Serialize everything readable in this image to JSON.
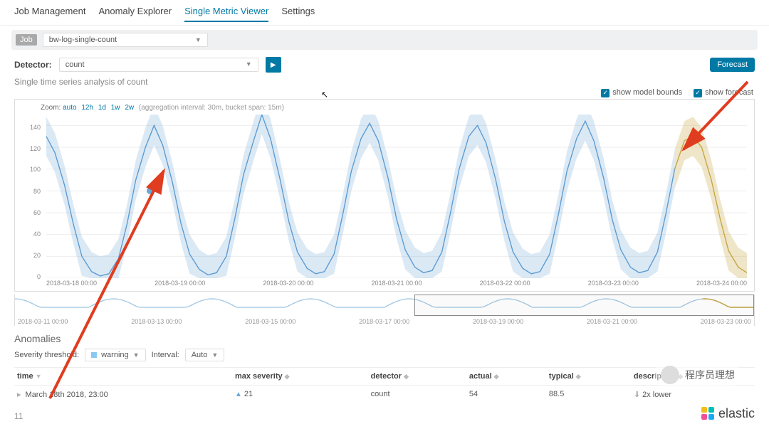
{
  "tabs": [
    "Job Management",
    "Anomaly Explorer",
    "Single Metric Viewer",
    "Settings"
  ],
  "active_tab": 2,
  "job": {
    "tag": "Job",
    "selected": "bw-log-single-count"
  },
  "detector": {
    "label": "Detector:",
    "selected": "count"
  },
  "forecast_label": "Forecast",
  "subtitle": "Single time series analysis of count",
  "checks": {
    "bounds": "show model bounds",
    "forecast": "show forecast"
  },
  "zoom": {
    "label": "Zoom:",
    "levels": [
      "auto",
      "12h",
      "1d",
      "1w",
      "2w"
    ],
    "agg": "(aggregation interval: 30m, bucket span: 15m)"
  },
  "chart_data": {
    "type": "line",
    "ylabel": "",
    "xlabel": "",
    "ylim": [
      0,
      150
    ],
    "yticks": [
      0,
      20,
      40,
      60,
      80,
      100,
      120,
      140
    ],
    "xticks": [
      "2018-03-18 00:00",
      "2018-03-19 00:00",
      "2018-03-20 00:00",
      "2018-03-21 00:00",
      "2018-03-22 00:00",
      "2018-03-23 00:00",
      "2018-03-24 00:00"
    ],
    "series": [
      {
        "name": "actual",
        "color": "#5c9bd1",
        "x": [
          0,
          0.08,
          0.17,
          0.25,
          0.33,
          0.42,
          0.5,
          0.58,
          0.67,
          0.75,
          0.83,
          0.92,
          1,
          1.08,
          1.17,
          1.25,
          1.33,
          1.42,
          1.5,
          1.58,
          1.67,
          1.75,
          1.83,
          1.92,
          2,
          2.08,
          2.17,
          2.25,
          2.33,
          2.42,
          2.5,
          2.58,
          2.67,
          2.75,
          2.83,
          2.92,
          3,
          3.08,
          3.17,
          3.25,
          3.33,
          3.42,
          3.5,
          3.58,
          3.67,
          3.75,
          3.83,
          3.92,
          4,
          4.08,
          4.17,
          4.25,
          4.33,
          4.42,
          4.5,
          4.58,
          4.67,
          4.75,
          4.83,
          4.92,
          5,
          5.08,
          5.17,
          5.25,
          5.33,
          5.42,
          5.5,
          5.58,
          5.67,
          5.75,
          5.83
        ],
        "values": [
          130,
          115,
          85,
          50,
          20,
          6,
          2,
          4,
          18,
          50,
          90,
          120,
          140,
          122,
          88,
          50,
          22,
          8,
          3,
          5,
          20,
          55,
          95,
          125,
          150,
          128,
          90,
          52,
          24,
          9,
          4,
          6,
          22,
          58,
          98,
          128,
          142,
          126,
          92,
          54,
          26,
          10,
          5,
          7,
          24,
          60,
          100,
          130,
          140,
          124,
          90,
          52,
          24,
          9,
          4,
          6,
          22,
          58,
          98,
          128,
          144,
          126,
          92,
          54,
          26,
          10,
          5,
          7,
          24,
          60,
          100
        ]
      },
      {
        "name": "forecast",
        "color": "#c5a642",
        "x": [
          5.83,
          5.92,
          6,
          6.08,
          6.17,
          6.25,
          6.33,
          6.42,
          6.5
        ],
        "values": [
          100,
          126,
          130,
          120,
          90,
          55,
          25,
          10,
          5
        ]
      }
    ],
    "bounds_delta": 18,
    "anomaly_marker": {
      "x": 0.96,
      "y": 80,
      "color": "#6aa7d6"
    }
  },
  "context": {
    "xticks": [
      "2018-03-11 00:00",
      "2018-03-13 00:00",
      "2018-03-15 00:00",
      "2018-03-17 00:00",
      "2018-03-19 00:00",
      "2018-03-21 00:00",
      "2018-03-23 00:00"
    ],
    "brush": {
      "left_pct": 54,
      "width_pct": 46
    }
  },
  "anomalies": {
    "title": "Anomalies",
    "severity_label": "Severity threshold:",
    "severity_value": "warning",
    "interval_label": "Interval:",
    "interval_value": "Auto",
    "columns": [
      "time",
      "max severity",
      "detector",
      "actual",
      "typical",
      "description"
    ],
    "rows": [
      {
        "time": "March 18th 2018, 23:00",
        "max_severity": "21",
        "detector": "count",
        "actual": "54",
        "typical": "88.5",
        "description": "2x lower"
      }
    ]
  },
  "page_number": "11",
  "brand": "elastic",
  "watermark": "程序员理想"
}
